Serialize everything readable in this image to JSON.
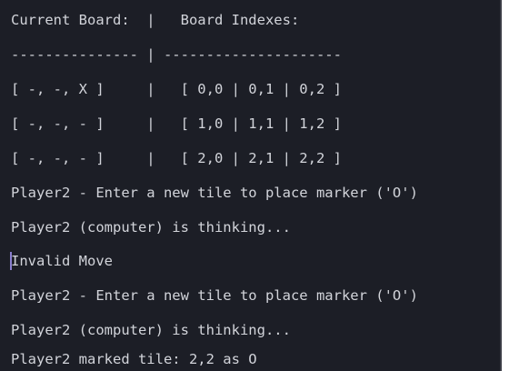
{
  "terminal": {
    "lines": [
      "Current Board:  |   Board Indexes:",
      "--------------- | ---------------------",
      "[ -, -, X ]     |   [ 0,0 | 0,1 | 0,2 ]",
      "[ -, -, - ]     |   [ 1,0 | 1,1 | 1,2 ]",
      "[ -, -, - ]     |   [ 2,0 | 2,1 | 2,2 ]",
      "Player2 - Enter a new tile to place marker ('O')",
      "Player2 (computer) is thinking...",
      "Invalid Move",
      "Player2 - Enter a new tile to place marker ('O')",
      "Player2 (computer) is thinking...",
      "Player2 marked tile: 2,2 as O"
    ]
  }
}
